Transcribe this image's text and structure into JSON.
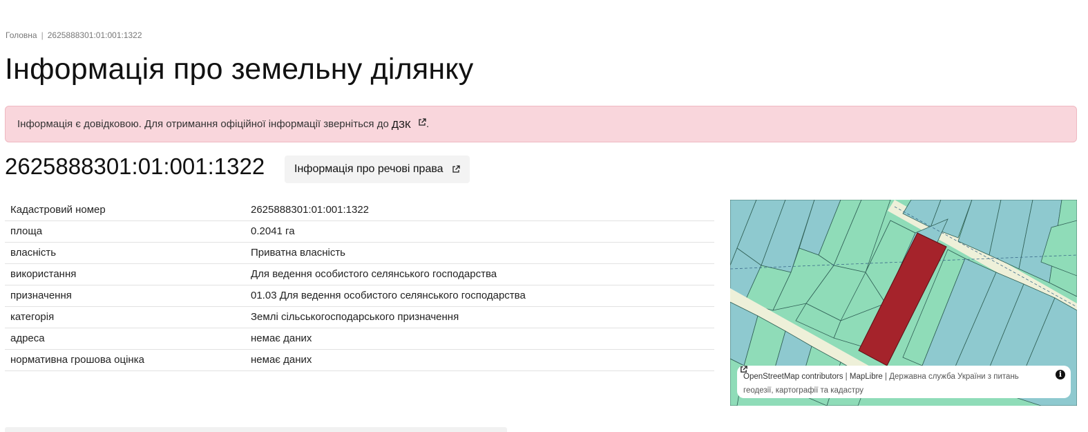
{
  "breadcrumb": {
    "home": "Головна",
    "separator": "|",
    "current": "2625888301:01:001:1322"
  },
  "page_title": "Інформація про земельну ділянку",
  "notice": {
    "text": "Інформація є довідковою. Для отримання офіційної інформації зверніться до",
    "link_label": "ДЗК",
    "suffix": ".",
    "background": "#f9d6dc"
  },
  "parcel": {
    "id": "2625888301:01:001:1322",
    "rights_button_label": "Інформація про речові права"
  },
  "table": {
    "rows": [
      {
        "key": "Кадастровий номер",
        "value": "2625888301:01:001:1322"
      },
      {
        "key": "площа",
        "value": "0.2041 га"
      },
      {
        "key": "власність",
        "value": "Приватна власність"
      },
      {
        "key": "використання",
        "value": "Для ведення особистого селянського господарства"
      },
      {
        "key": "призначення",
        "value": "01.03 Для ведення особистого селянського господарства"
      },
      {
        "key": "категорія",
        "value": "Землі сільськогосподарського призначення"
      },
      {
        "key": "адреса",
        "value": "немає даних"
      },
      {
        "key": "нормативна грошова оцінка",
        "value": "немає даних"
      }
    ]
  },
  "map": {
    "colors": {
      "parcel_green": "#8fdcb8",
      "parcel_blue": "#8ec9cf",
      "road": "#eef0d9",
      "selected_parcel": "#a5232b"
    },
    "attribution": {
      "osm": "OpenStreetMap contributors",
      "sep1": "|",
      "maplibre": "MapLibre",
      "sep2": "|",
      "dzk": "Державна служба України з питань геодезії, картографії та кадастру"
    },
    "info_icon": "i"
  },
  "icons": {
    "external_link": "external-link-icon",
    "info": "info-icon"
  }
}
